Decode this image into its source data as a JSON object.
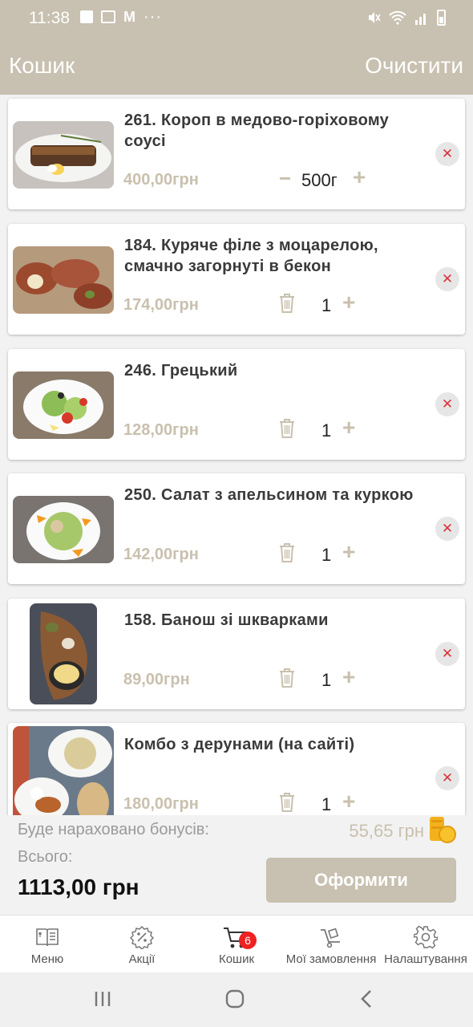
{
  "status_bar": {
    "time": "11:38"
  },
  "header": {
    "title": "Кошик",
    "clear_label": "Очистити"
  },
  "cart_items": [
    {
      "name": "261. Короп в медово-горіховому соусі",
      "price": "400,00грн",
      "quantity": "500г",
      "control": "minus"
    },
    {
      "name": "184. Куряче філе з моцарелою, смачно загорнуті в бекон",
      "price": "174,00грн",
      "quantity": "1",
      "control": "trash"
    },
    {
      "name": "246. Грецький",
      "price": "128,00грн",
      "quantity": "1",
      "control": "trash"
    },
    {
      "name": "250. Салат з апельсином та куркою",
      "price": "142,00грн",
      "quantity": "1",
      "control": "trash"
    },
    {
      "name": "158. Банош зі шкварками",
      "price": "89,00грн",
      "quantity": "1",
      "control": "trash"
    },
    {
      "name": "Комбо з дерунами (на сайті)",
      "price": "180,00грн",
      "quantity": "1",
      "control": "trash"
    }
  ],
  "controls": {
    "minus": "−",
    "plus": "+",
    "remove": "✕"
  },
  "summary": {
    "bonus_label": "Буде нараховано бонусів:",
    "bonus_value": "55,65 грн",
    "total_label": "Всього:",
    "total_value": "1113,00 грн",
    "checkout_label": "Оформити"
  },
  "bottom_nav": [
    {
      "label": "Меню",
      "icon": "menu-book-icon"
    },
    {
      "label": "Акції",
      "icon": "percent-badge-icon"
    },
    {
      "label": "Кошик",
      "icon": "cart-icon",
      "badge": "6"
    },
    {
      "label": "Мої замовлення",
      "icon": "delivery-cart-icon"
    },
    {
      "label": "Налаштування",
      "icon": "gear-icon"
    }
  ],
  "colors": {
    "accent": "#c8c0b0",
    "price": "#c9c0ae",
    "remove": "#d9343a",
    "badge": "#e22222"
  }
}
